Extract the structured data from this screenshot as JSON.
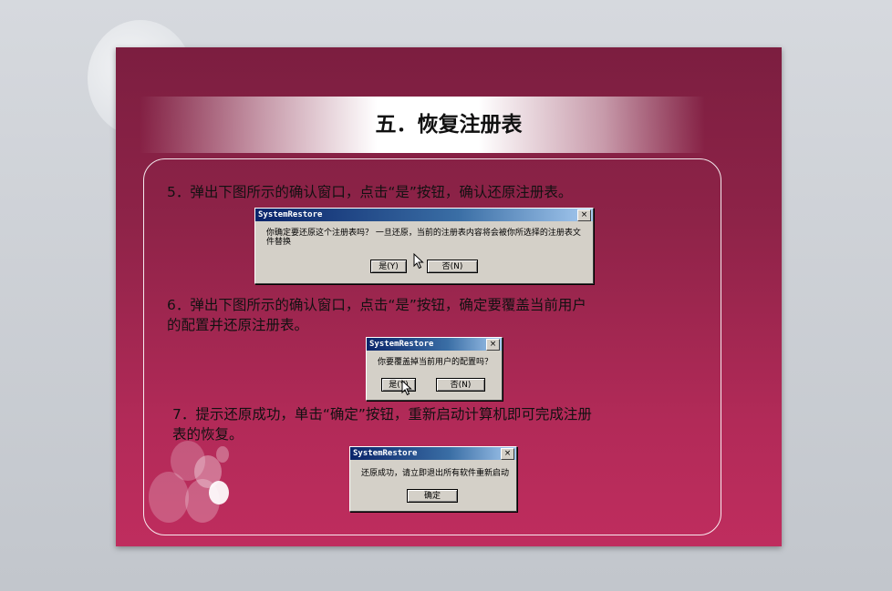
{
  "slide": {
    "title": "五．恢复注册表",
    "steps": [
      {
        "text": "5．弹出下图所示的确认窗口，点击“是”按钮，确认还原注册表。",
        "dialog": {
          "title": "SystemRestore",
          "close": "×",
          "message": "你确定要还原这个注册表吗？ 一旦还原，当前的注册表内容将会被你所选择的注册表文件替换",
          "buttons": [
            "是(Y)",
            "否(N)"
          ]
        }
      },
      {
        "text_line1": "6．弹出下图所示的确认窗口，点击“是”按钮，确定要覆盖当前用户",
        "text_line2": "的配置并还原注册表。",
        "dialog": {
          "title": "SystemRestore",
          "close": "×",
          "message": "你要覆盖掉当前用户的配置吗？",
          "buttons": [
            "是(Y)",
            "否(N)"
          ]
        }
      },
      {
        "text_line1": "7．提示还原成功，单击“确定”按钮，重新启动计算机即可完成注册",
        "text_line2": "表的恢复。",
        "dialog": {
          "title": "SystemRestore",
          "close": "×",
          "message": "还原成功，请立即退出所有软件重新启动",
          "buttons": [
            "确定"
          ]
        }
      }
    ]
  },
  "colors": {
    "slide_top": "#7c1e40",
    "slide_bottom": "#bf2d5e",
    "dialog_face": "#d4d0c8",
    "titlebar_start": "#0a246a"
  },
  "icons": [
    "mouse-cursor-icon",
    "close-icon"
  ]
}
